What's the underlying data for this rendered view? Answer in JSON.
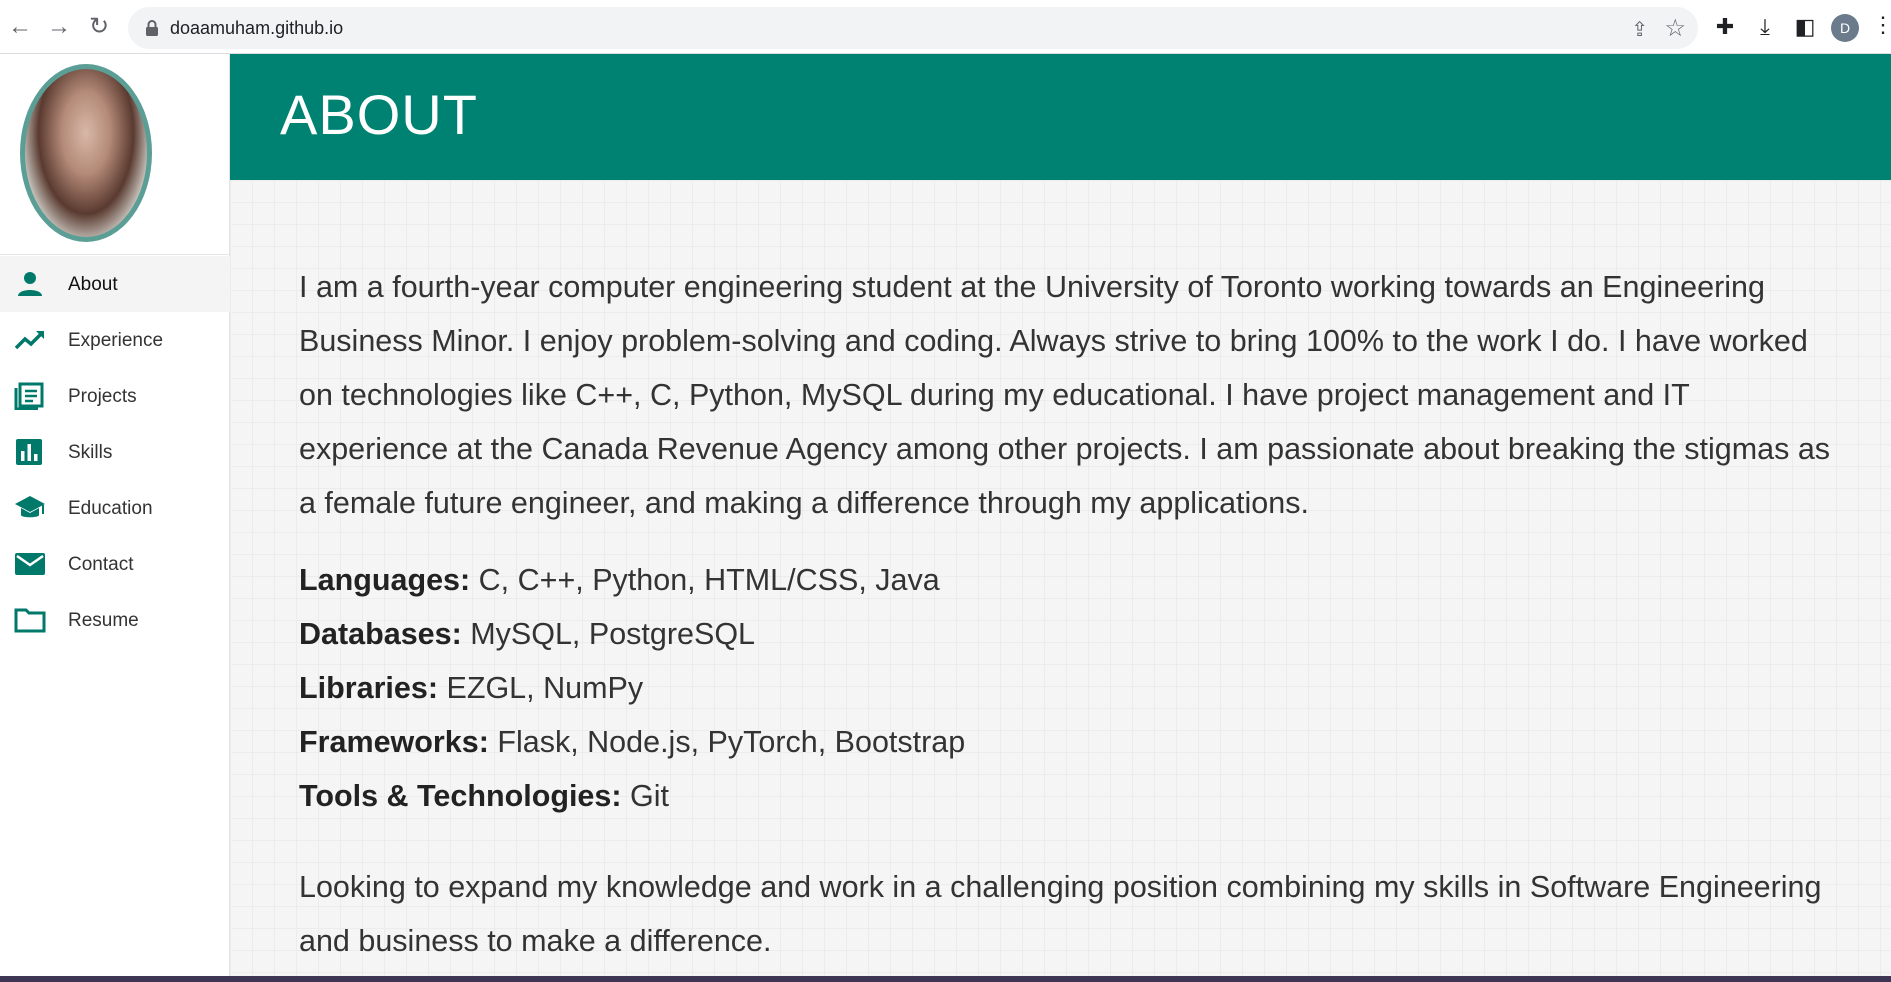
{
  "browser": {
    "url": "doaamuham.github.io",
    "profile_initial": "D"
  },
  "sidebar": {
    "items": [
      {
        "label": "About",
        "icon": "person-icon",
        "active": true
      },
      {
        "label": "Experience",
        "icon": "trending-up-icon",
        "active": false
      },
      {
        "label": "Projects",
        "icon": "list-icon",
        "active": false
      },
      {
        "label": "Skills",
        "icon": "bar-chart-icon",
        "active": false
      },
      {
        "label": "Education",
        "icon": "graduation-cap-icon",
        "active": false
      },
      {
        "label": "Contact",
        "icon": "mail-icon",
        "active": false
      },
      {
        "label": "Resume",
        "icon": "folder-icon",
        "active": false
      }
    ]
  },
  "header": {
    "title": "ABOUT",
    "color": "#008273"
  },
  "about": {
    "intro": "I am a fourth-year computer engineering student at the University of Toronto working towards an Engineering Business Minor. I enjoy problem-solving and coding. Always strive to bring 100% to the work I do. I have worked on technologies like C++, C, Python, MySQL during my educational. I have project management and IT experience at the Canada Revenue Agency among other projects. I am passionate about breaking the stigmas as a female future engineer, and making a difference through my applications.",
    "skills": [
      {
        "label": "Languages:",
        "value": " C, C++, Python, HTML/CSS, Java"
      },
      {
        "label": "Databases:",
        "value": " MySQL, PostgreSQL"
      },
      {
        "label": "Libraries:",
        "value": " EZGL, NumPy"
      },
      {
        "label": "Frameworks:",
        "value": " Flask, Node.js, PyTorch, Bootstrap"
      },
      {
        "label": "Tools & Technologies:",
        "value": " Git"
      }
    ],
    "closing": "Looking to expand my knowledge and work in a challenging position combining my skills in Software Engineering and business to make a difference."
  }
}
